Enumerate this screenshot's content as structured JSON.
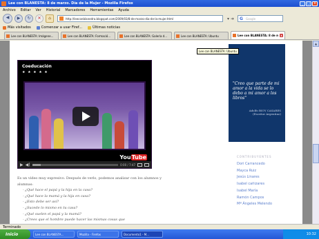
{
  "window": {
    "title": "Lee con BLANESTA: 8 de marzo. Día de la Mujer - Mozilla Firefox",
    "min": "_",
    "max": "□",
    "close": "x"
  },
  "menu": [
    "Archivo",
    "Editar",
    "Ver",
    "Historial",
    "Marcadores",
    "Herramientas",
    "Ayuda"
  ],
  "nav": {
    "back": "◀",
    "forward": "▶",
    "reload": "↻",
    "stop": "✕",
    "home": "⌂",
    "url": "http://leeconblanedra.blogspot.com/2009/03/8-de-marzo-dia-de-la-mujer.html",
    "search_placeholder": "Google",
    "search_engine": "G"
  },
  "bookmarks": [
    {
      "label": "Más visitados",
      "icon": "orange"
    },
    {
      "label": "Comenzar a usar Firef...",
      "icon": "blue"
    },
    {
      "label": "Últimas noticias",
      "icon": "yellow"
    }
  ],
  "tabs": [
    {
      "label": "Lee con BLANESTA: Imágene...",
      "active": false
    },
    {
      "label": "Lee con BLANESTA: Formació...",
      "active": false
    },
    {
      "label": "Lee con BLANESTA: Galería d...",
      "active": false
    },
    {
      "label": "Lee con BLANESTA: Ubuntu",
      "active": false
    },
    {
      "label": "Lee con BLANESTA: 8 de m...",
      "active": true
    }
  ],
  "tooltip": "Lee con BLANESTA: Ubuntu",
  "video": {
    "title": "Coeducación",
    "stars": "★ ★ ★ ★ ★",
    "time": "0:00 / 7:47",
    "progress": 0.1,
    "logo_you": "You",
    "logo_tube": "Tube"
  },
  "article": {
    "intro": "Es un vídeo muy expresivo. Después de verlo, podemos analizar con los alumnos y alumnas:",
    "questions": [
      "- ¿Qué hace el papá y la hija en la casa?",
      "- ¿Qué hace la mamá y la hija en casa?",
      "- ¿Esto debe ser así?",
      "- ¿Sucede lo mismo en tu casa?",
      "- ¿Qué suelen el papá y la mamá?",
      "- ¿Crees que el hombre puede hacer las mismas cosas que"
    ]
  },
  "sidebar": {
    "quote": "\"Creo que parte de mi amor a la vida se lo debo a mi amor a los libros\"",
    "author": "Adolfo BIOY CASARES",
    "author_note": "(Escritor Argentino)",
    "contributors_heading": "CONTRIBUYENTES",
    "contributors": [
      "Dori Carrancedo",
      "Mayca Ruiz",
      "Jesús Linares",
      "Isabel cañizares",
      "Isabel María",
      "Ramón Campos",
      "Mª Ángeles Melendo"
    ]
  },
  "status": "Terminado",
  "taskbar": {
    "start": "Inicio",
    "tasks": [
      "Lee con BLANESTA...",
      "Mozilla - Firefox",
      "Documento1 - M..."
    ],
    "clock": "10:32"
  },
  "colors": {
    "sidebar_bg": "#10366b",
    "link": "#5b7fcc",
    "titlebar": "#3169e0"
  }
}
